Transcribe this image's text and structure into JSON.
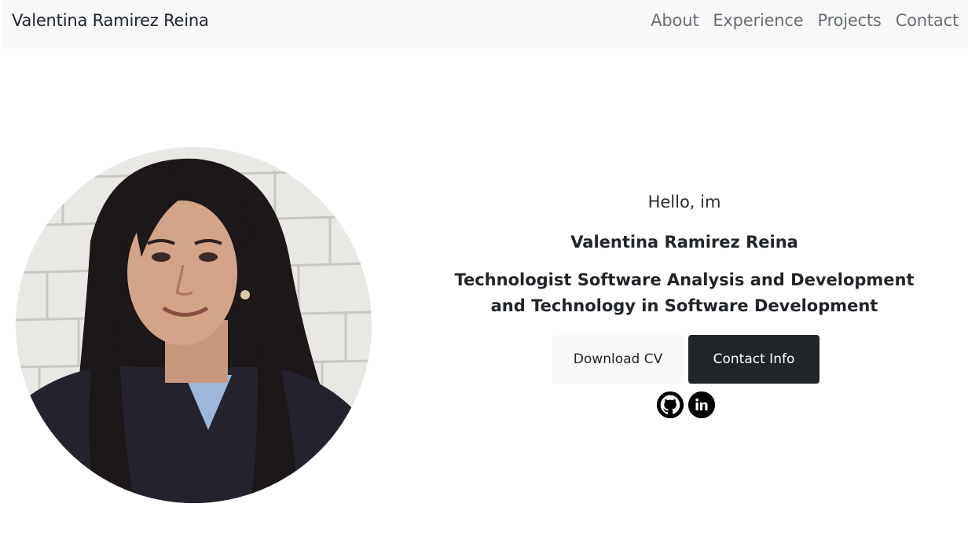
{
  "nav": {
    "brand": "Valentina Ramirez Reina",
    "links": [
      "About",
      "Experience",
      "Projects",
      "Contact"
    ]
  },
  "hero": {
    "greeting": "Hello, im",
    "name": "Valentina Ramirez Reina",
    "title_line1": "Technologist Software Analysis and Development",
    "title_line2": "and Technology in Software Development",
    "download_label": "Download CV",
    "contact_label": "Contact Info"
  },
  "socials": {
    "github_icon": "github-icon",
    "linkedin_icon": "linkedin-icon"
  },
  "colors": {
    "navbar_bg": "#f8f9fa",
    "dark_button": "#212529",
    "light_button": "#f8f9fa",
    "nav_link": "#6b6e71"
  }
}
